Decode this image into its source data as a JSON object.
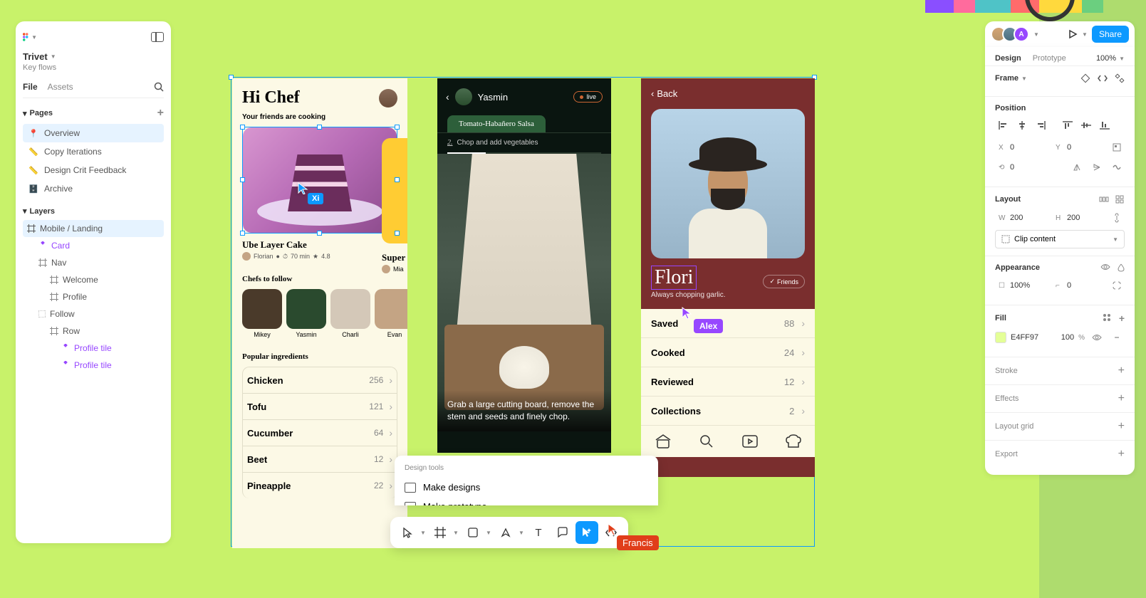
{
  "project": {
    "name": "Trivet",
    "sub": "Key flows"
  },
  "tabs": {
    "file": "File",
    "assets": "Assets"
  },
  "sections": {
    "pages": "Pages",
    "layers": "Layers"
  },
  "pages": [
    {
      "icon": "📍",
      "name": "Overview"
    },
    {
      "icon": "📏",
      "name": "Copy Iterations"
    },
    {
      "icon": "📏",
      "name": "Design Crit Feedback"
    },
    {
      "icon": "🗄️",
      "name": "Archive"
    }
  ],
  "layers": {
    "root": "Mobile / Landing",
    "card": "Card",
    "nav": "Nav",
    "welcome": "Welcome",
    "profile": "Profile",
    "follow": "Follow",
    "row": "Row",
    "tile1": "Profile tile",
    "tile2": "Profile tile"
  },
  "topbar": {
    "avatar_letter": "A",
    "share": "Share"
  },
  "rp": {
    "tabs": {
      "design": "Design",
      "prototype": "Prototype"
    },
    "zoom": "100%",
    "frame": "Frame",
    "position": "Position",
    "x": "0",
    "y": "0",
    "rot": "0",
    "layout": "Layout",
    "w": "200",
    "h": "200",
    "clip": "Clip content",
    "appearance": "Appearance",
    "opacity": "100%",
    "radius": "0",
    "fill": "Fill",
    "fill_hex": "E4FF97",
    "fill_pct": "100",
    "fill_unit": "%",
    "stroke": "Stroke",
    "effects": "Effects",
    "grid": "Layout grid",
    "export": "Export"
  },
  "m1": {
    "title": "Hi Chef",
    "subtitle": "Your friends are cooking",
    "card_title": "Ube Layer Cake",
    "card_title2": "Super",
    "author": "Florian",
    "time": "70 min",
    "rating": "4.8",
    "author2": "Mia",
    "chefs_title": "Chefs to follow",
    "chefs": [
      "Mikey",
      "Yasmin",
      "Charli",
      "Evan"
    ],
    "ing_title": "Popular ingredients",
    "ingredients": [
      {
        "name": "Chicken",
        "count": "256"
      },
      {
        "name": "Tofu",
        "count": "121"
      },
      {
        "name": "Cucumber",
        "count": "64"
      },
      {
        "name": "Beet",
        "count": "12"
      },
      {
        "name": "Pineapple",
        "count": "22"
      }
    ]
  },
  "m2": {
    "name": "Yasmin",
    "live": "live",
    "tab": "Tomato-Habañero Salsa",
    "step_num": "2.",
    "step": "Chop and add vegetables",
    "caption": "Grab a large cutting board, remove the stem and seeds and finely chop."
  },
  "m3": {
    "back": "Back",
    "name": "Flori",
    "friends": "Friends",
    "bio": "Always chopping garlic.",
    "stats": [
      {
        "name": "Saved",
        "val": "88"
      },
      {
        "name": "Cooked",
        "val": "24"
      },
      {
        "name": "Reviewed",
        "val": "12"
      },
      {
        "name": "Collections",
        "val": "2"
      }
    ]
  },
  "ai_menu": {
    "title": "Design tools",
    "item1": "Make designs",
    "item2": "Make prototype"
  },
  "cursors": {
    "xi": "Xi",
    "alex": "Alex",
    "francis": "Francis"
  }
}
